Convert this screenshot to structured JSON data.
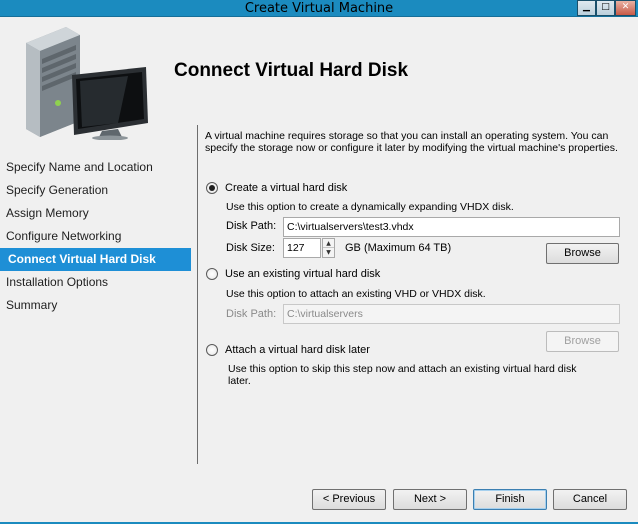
{
  "window": {
    "title": "Create Virtual Machine",
    "min_glyph": "▁",
    "max_glyph": "□",
    "close_glyph": "✕"
  },
  "header": {
    "heading": "Connect Virtual Hard Disk",
    "image_icon": "server-monitor-icon"
  },
  "sidebar": {
    "items": [
      {
        "label": "Specify Name and Location",
        "active": false
      },
      {
        "label": "Specify Generation",
        "active": false
      },
      {
        "label": "Assign Memory",
        "active": false
      },
      {
        "label": "Configure Networking",
        "active": false
      },
      {
        "label": "Connect Virtual Hard Disk",
        "active": true
      },
      {
        "label": "Installation Options",
        "active": false
      },
      {
        "label": "Summary",
        "active": false
      }
    ],
    "active_color": "#1e8fd6"
  },
  "main": {
    "intro": "A virtual machine requires storage so that you can install an operating system. You can specify the storage now or configure it later by modifying the virtual machine's properties.",
    "create_option": {
      "label": "Create a virtual hard disk",
      "selected": true,
      "description": "Use this option to create a dynamically expanding VHDX disk.",
      "path_label": "Disk Path:",
      "path_value": "C:\\virtualservers\\test3.vhdx",
      "size_label": "Disk Size:",
      "size_value": "127",
      "size_suffix": "GB (Maximum 64 TB)",
      "browse_label": "Browse"
    },
    "existing_option": {
      "label": "Use an existing virtual hard disk",
      "selected": false,
      "description": "Use this option to attach an existing VHD or VHDX disk.",
      "path_label": "Disk Path:",
      "path_value": "C:\\virtualservers",
      "browse_label": "Browse"
    },
    "later_option": {
      "label": "Attach a virtual hard disk later",
      "selected": false,
      "description": "Use this option to skip this step now and attach an existing virtual hard disk later."
    }
  },
  "footer": {
    "previous_label": "< Previous",
    "next_label": "Next >",
    "finish_label": "Finish",
    "cancel_label": "Cancel"
  }
}
